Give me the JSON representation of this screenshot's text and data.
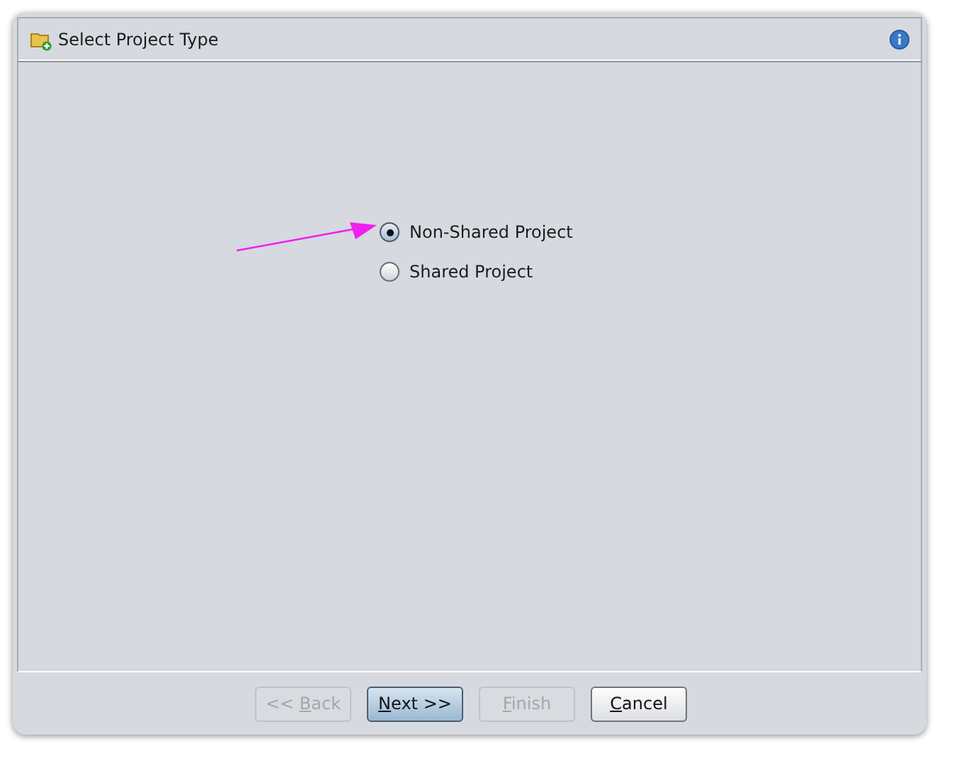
{
  "window": {
    "title": "Select Project Type"
  },
  "options": [
    {
      "label": "Non-Shared Project",
      "selected": true
    },
    {
      "label": "Shared Project",
      "selected": false
    }
  ],
  "annotation": {
    "kind": "arrow"
  },
  "buttons": [
    {
      "before": "<< ",
      "key": "B",
      "after": "ack",
      "disabled": true,
      "default": false
    },
    {
      "key": "N",
      "after": "ext >>",
      "disabled": false,
      "default": true
    },
    {
      "key": "F",
      "after": "inish",
      "disabled": true,
      "default": false
    },
    {
      "key": "C",
      "after": "ancel",
      "disabled": false,
      "default": false
    }
  ]
}
